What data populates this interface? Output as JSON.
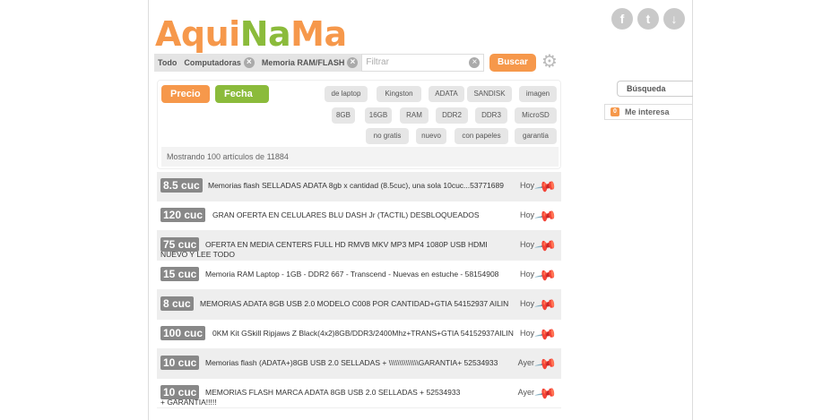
{
  "logo": {
    "parts": [
      {
        "text": "Aqui",
        "color": "#f6984b"
      },
      {
        "text": "Na",
        "color": "#8bbb3b"
      },
      {
        "text": "Ma",
        "color": "#f6984b"
      }
    ]
  },
  "social": [
    {
      "icon": "facebook-icon",
      "glyph": "f"
    },
    {
      "icon": "twitter-icon",
      "glyph": "t"
    },
    {
      "icon": "download-icon",
      "glyph": "↓"
    }
  ],
  "breadcrumbs": {
    "todo": "Todo",
    "computadoras": "Computadoras",
    "memoria": "Memoria RAM/FLASH"
  },
  "search": {
    "placeholder": "Filtrar",
    "button": "Buscar"
  },
  "sort": {
    "precio": "Precio",
    "fecha": "Fecha ▼"
  },
  "tags": {
    "row1": [
      "de laptop",
      "Kingston",
      "ADATA",
      "SANDISK",
      "imagen"
    ],
    "row2": [
      "8GB",
      "16GB",
      "RAM",
      "DDR2",
      "DDR3",
      "MicroSD"
    ],
    "row3": [
      "no gratis",
      "nuevo",
      "con papeles",
      "garantia"
    ]
  },
  "showing": "Mostrando 100 artículos de 11884",
  "results": [
    {
      "price": "8.5 cuc",
      "title": "Memorias flash SELLADAS ADATA 8gb x cantidad (8.5cuc), una sola 10cuc...53771689",
      "date": "Hoy"
    },
    {
      "price": "120 cuc",
      "title": "GRAN OFERTA EN CELULARES BLU DASH Jr (TACTIL) DESBLOQUEADOS",
      "date": "Hoy"
    },
    {
      "price": "75 cuc",
      "title": "OFERTA EN MEDIA CENTERS FULL HD RMVB MKV MP3 MP4 1080P USB HDMI NUEVO Y LEE TODO",
      "date": "Hoy"
    },
    {
      "price": "15 cuc",
      "title": "Memoria RAM Laptop - 1GB - DDR2 667 - Transcend - Nuevas en estuche - 58154908",
      "date": "Hoy"
    },
    {
      "price": "8 cuc",
      "title": "MEMORIAS ADATA 8GB USB 2.0 MODELO C008 POR CANTIDAD+GTIA 54152937 AILIN",
      "date": "Hoy"
    },
    {
      "price": "100 cuc",
      "title": "0KM Kit GSkill Ripjaws Z Black(4x2)8GB/DDR3/2400Mhz+TRANS+GTIA 54152937AILIN",
      "date": "Hoy"
    },
    {
      "price": "10 cuc",
      "title": "Memorias flash (ADATA+)8GB USB 2.0 SELLADAS + \\\\\\\\\\\\\\\\\\\\\\\\\\\\GARANTIA+ 52534933",
      "date": "Ayer"
    },
    {
      "price": "10 cuc",
      "title": "MEMORIAS FLASH MARCA ADATA 8GB USB 2.0 SELLADAS + 52534933 + GARANTIA!!!!!",
      "date": "Ayer"
    }
  ],
  "sidebar": {
    "busqueda": "Búsqueda",
    "interesa_count": "0",
    "interesa": "Me interesa"
  }
}
